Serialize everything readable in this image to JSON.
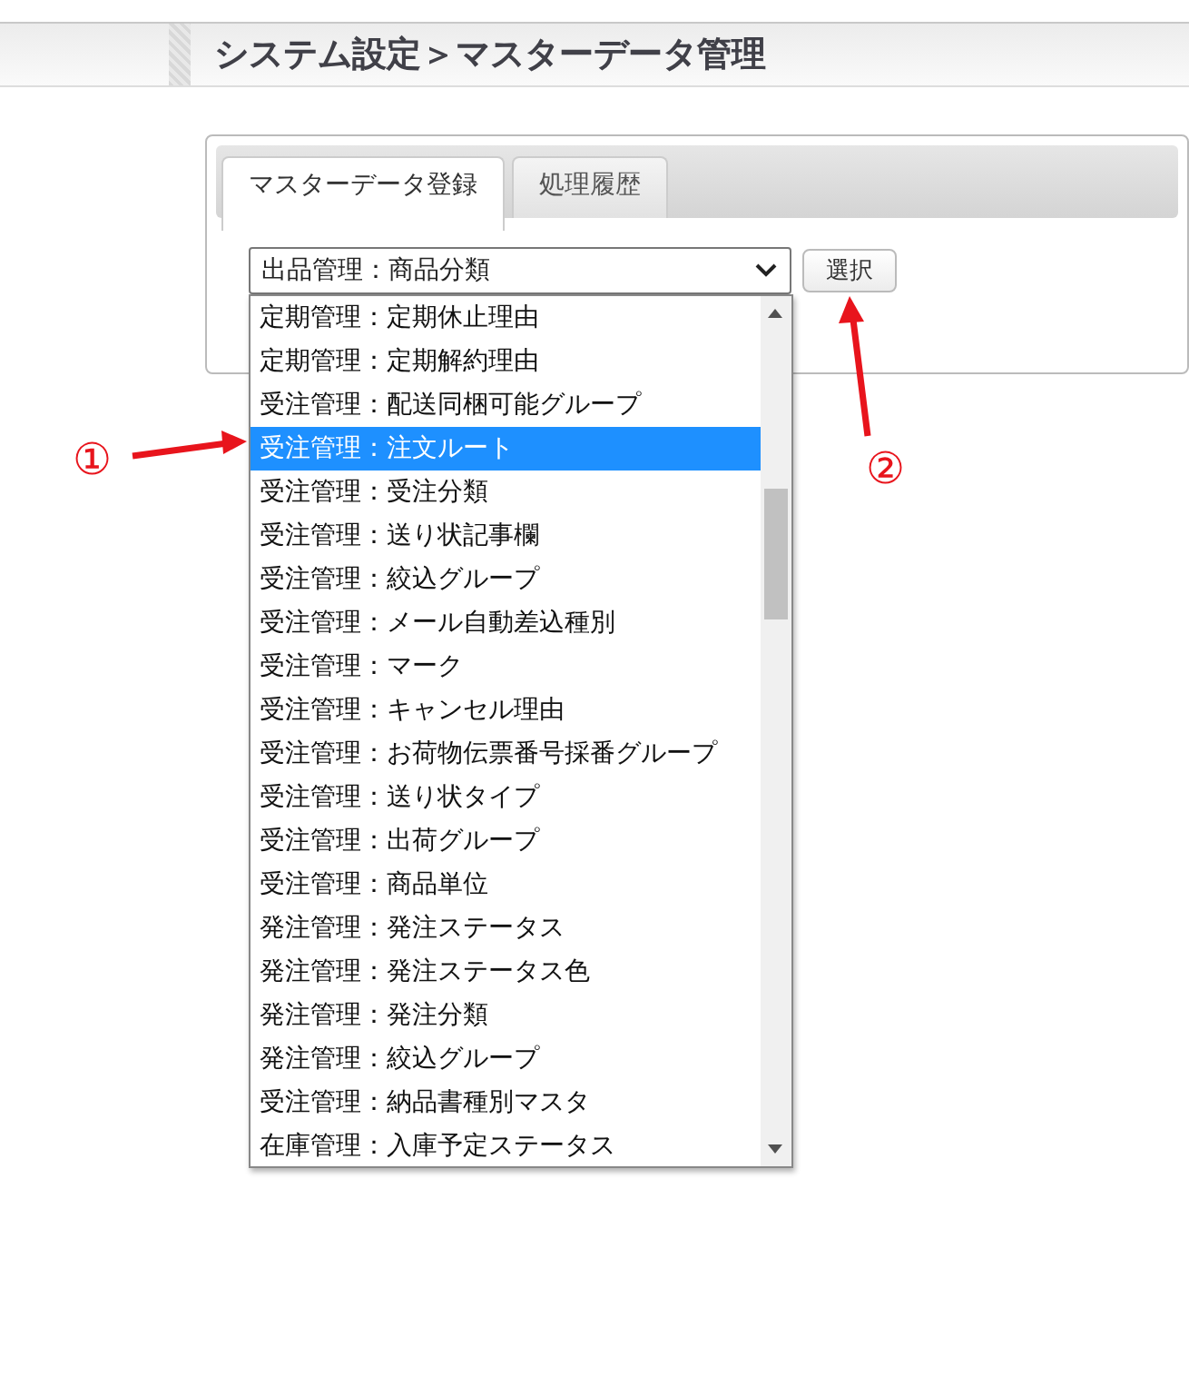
{
  "page_title": "システム設定＞マスターデータ管理",
  "tabs": [
    {
      "label": "マスターデータ登録",
      "selected": true
    },
    {
      "label": "処理履歴",
      "selected": false
    }
  ],
  "select": {
    "value": "出品管理：商品分類"
  },
  "select_button": "選択",
  "dropdown_options": [
    {
      "label": "定期管理：定期休止理由",
      "selected": false
    },
    {
      "label": "定期管理：定期解約理由",
      "selected": false
    },
    {
      "label": "受注管理：配送同梱可能グループ",
      "selected": false
    },
    {
      "label": "受注管理：注文ルート",
      "selected": true
    },
    {
      "label": "受注管理：受注分類",
      "selected": false
    },
    {
      "label": "受注管理：送り状記事欄",
      "selected": false
    },
    {
      "label": "受注管理：絞込グループ",
      "selected": false
    },
    {
      "label": "受注管理：メール自動差込種別",
      "selected": false
    },
    {
      "label": "受注管理：マーク",
      "selected": false
    },
    {
      "label": "受注管理：キャンセル理由",
      "selected": false
    },
    {
      "label": "受注管理：お荷物伝票番号採番グループ",
      "selected": false
    },
    {
      "label": "受注管理：送り状タイプ",
      "selected": false
    },
    {
      "label": "受注管理：出荷グループ",
      "selected": false
    },
    {
      "label": "受注管理：商品単位",
      "selected": false
    },
    {
      "label": "発注管理：発注ステータス",
      "selected": false
    },
    {
      "label": "発注管理：発注ステータス色",
      "selected": false
    },
    {
      "label": "発注管理：発注分類",
      "selected": false
    },
    {
      "label": "発注管理：絞込グループ",
      "selected": false
    },
    {
      "label": "受注管理：納品書種別マスタ",
      "selected": false
    },
    {
      "label": "在庫管理：入庫予定ステータス",
      "selected": false
    }
  ],
  "annotations": [
    {
      "label": "①"
    },
    {
      "label": "②"
    }
  ]
}
